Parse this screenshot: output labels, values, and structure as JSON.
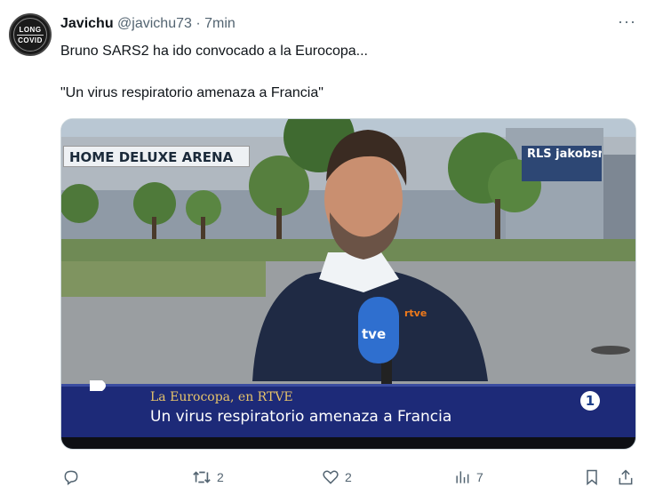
{
  "tweet": {
    "author_name": "Javichu",
    "handle": "@javichu73",
    "separator": "·",
    "time": "7min",
    "more_label": "···",
    "avatar_text_1": "LONG",
    "avatar_text_2": "COVID",
    "text_line_1": "Bruno SARS2 ha ido convocado a la Eurocopa...",
    "text_line_2": "\"Un virus respiratorio amenaza a Francia\""
  },
  "media": {
    "arena_sign": "HOME DELUXE ARENA",
    "rls_sign": "RLS jakobsmeyer",
    "mic_text": "tve",
    "rtve_badge": "rtve",
    "chyron_top": "La Eurocopa, en RTVE",
    "chyron_main": "Un virus respiratorio amenaza a Francia",
    "channel_number": "1"
  },
  "actions": {
    "reply_count": "",
    "retweet_count": "2",
    "like_count": "2",
    "views_count": "7"
  },
  "colors": {
    "text_primary": "#0f1419",
    "text_secondary": "#536471",
    "chyron_bg": "#1d2a78",
    "chyron_accent": "#e6c36a"
  }
}
